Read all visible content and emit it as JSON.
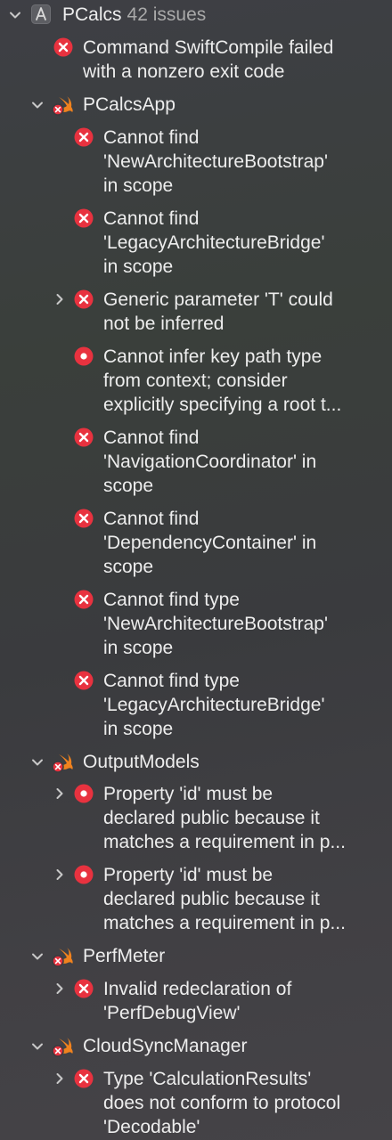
{
  "project": {
    "name": "PCalcs",
    "count": "42 issues"
  },
  "top_error": {
    "lines": [
      "Command SwiftCompile failed",
      "with a nonzero exit code"
    ]
  },
  "groups": [
    {
      "name": "PCalcsApp",
      "items": [
        {
          "kind": "x",
          "lines": [
            "Cannot find",
            "'NewArchitectureBootstrap'",
            "in scope"
          ]
        },
        {
          "kind": "x",
          "lines": [
            "Cannot find",
            "'LegacyArchitectureBridge'",
            "in scope"
          ]
        },
        {
          "kind": "x",
          "lines": [
            "Generic parameter 'T' could",
            "not be inferred"
          ]
        },
        {
          "kind": "dot",
          "lines": [
            "Cannot infer key path type",
            "from context; consider",
            "explicitly specifying a root t..."
          ]
        },
        {
          "kind": "x",
          "lines": [
            "Cannot find",
            "'NavigationCoordinator' in",
            "scope"
          ]
        },
        {
          "kind": "x",
          "lines": [
            "Cannot find",
            "'DependencyContainer' in",
            "scope"
          ]
        },
        {
          "kind": "x",
          "lines": [
            "Cannot find type",
            "'NewArchitectureBootstrap'",
            "in scope"
          ]
        },
        {
          "kind": "x",
          "lines": [
            "Cannot find type",
            "'LegacyArchitectureBridge'",
            "in scope"
          ]
        }
      ]
    },
    {
      "name": "OutputModels",
      "items": [
        {
          "kind": "dot",
          "lines": [
            "Property 'id' must be",
            "declared public because it",
            "matches a requirement in p..."
          ]
        },
        {
          "kind": "dot",
          "lines": [
            "Property 'id' must be",
            "declared public because it",
            "matches a requirement in p..."
          ]
        }
      ]
    },
    {
      "name": "PerfMeter",
      "items": [
        {
          "kind": "x",
          "lines": [
            "Invalid redeclaration of",
            "'PerfDebugView'"
          ]
        }
      ]
    },
    {
      "name": "CloudSyncManager",
      "items": [
        {
          "kind": "x",
          "lines": [
            "Type 'CalculationResults'",
            "does not conform to protocol",
            "'Decodable'"
          ]
        }
      ]
    }
  ],
  "colors": {
    "error": "#e8323f",
    "swift": "#f0821e"
  }
}
